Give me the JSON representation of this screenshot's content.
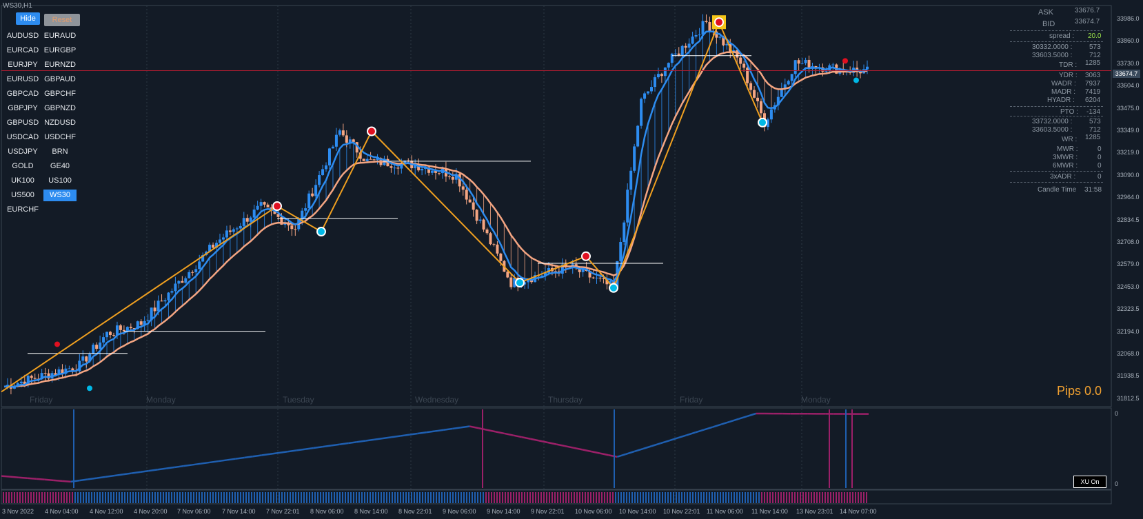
{
  "window": {
    "title": "WS30,H1"
  },
  "buttons": {
    "hide": "Hide",
    "reset": "Reset"
  },
  "symbols": [
    "AUDUSD",
    "EURAUD",
    "EURCAD",
    "EURGBP",
    "EURJPY",
    "EURNZD",
    "EURUSD",
    "GBPAUD",
    "GBPCAD",
    "GBPCHF",
    "GBPJPY",
    "GBPNZD",
    "GBPUSD",
    "NZDUSD",
    "USDCAD",
    "USDCHF",
    "USDJPY",
    "BRN",
    "GOLD",
    "GE40",
    "UK100",
    "US100",
    "US500",
    "WS30",
    "EURCHF"
  ],
  "active_symbol": "WS30",
  "info_panel": {
    "ask_label": "ASK",
    "ask_value": "33676.7",
    "bid_label": "BID",
    "bid_value": "33674.7",
    "spread_label": "spread :",
    "spread_value": "20.0",
    "r1_label": "30332.0000 :",
    "r1_value": "573",
    "r2_label": "33603.5000 :",
    "r2_value": "712",
    "tdr_label": "TDR :",
    "tdr_value": "1285",
    "ydr_label": "YDR :",
    "ydr_value": "3063",
    "wadr_label": "WADR :",
    "wadr_value": "7937",
    "madr_label": "MADR :",
    "madr_value": "7419",
    "hyadr_label": "HYADR :",
    "hyadr_value": "6204",
    "pto_label": "PTO :",
    "pto_value": "-134",
    "r3_label": "33732.0000 :",
    "r3_value": "573",
    "r4_label": "33603.5000 :",
    "r4_value": "712",
    "wr_label": "WR :",
    "wr_value": "1285",
    "mwr_label": "MWR :",
    "mwr_value": "0",
    "mwr3_label": "3MWR :",
    "mwr3_value": "0",
    "mwr6_label": "6MWR :",
    "mwr6_value": "0",
    "adr3_label": "3xADR :",
    "adr3_value": "0",
    "candle_label": "Candle Time",
    "candle_value": "31:58"
  },
  "price_axis": [
    "33986.0",
    "33860.0",
    "33730.0",
    "33604.0",
    "33475.0",
    "33349.0",
    "33219.0",
    "33090.0",
    "32964.0",
    "32834.5",
    "32708.0",
    "32579.0",
    "32453.0",
    "32323.5",
    "32194.0",
    "32068.0",
    "31938.5",
    "31812.5"
  ],
  "current_price": "33674.7",
  "time_axis": [
    "3 Nov 2022",
    "4 Nov 04:00",
    "4 Nov 12:00",
    "4 Nov 20:00",
    "7 Nov 06:00",
    "7 Nov 14:00",
    "7 Nov 22:01",
    "8 Nov 06:00",
    "8 Nov 14:00",
    "8 Nov 22:01",
    "9 Nov 06:00",
    "9 Nov 14:00",
    "9 Nov 22:01",
    "10 Nov 06:00",
    "10 Nov 14:00",
    "10 Nov 22:01",
    "11 Nov 06:00",
    "11 Nov 14:00",
    "13 Nov 23:01",
    "14 Nov 07:00"
  ],
  "day_labels": [
    "Friday",
    "Monday",
    "Tuesday",
    "Wednesday",
    "Thursday",
    "Friday",
    "Monday"
  ],
  "pips": "Pips 0.0",
  "xu_button": "XU On",
  "indicator_axis": {
    "top": "0",
    "bottom": "0"
  },
  "colors": {
    "bull": "#2d8cf0",
    "bear": "#f4a582",
    "zigzag": "#f0a020",
    "ma_fast": "#2d8cf0",
    "ma_slow": "#f4a582",
    "price_line": "#b01c30",
    "ind_up": "#1f5fb0",
    "ind_down": "#9b2068"
  },
  "chart_data": {
    "type": "candlestick",
    "title": "WS30,H1",
    "price_range": [
      31812.5,
      33986.0
    ],
    "zigzag": [
      {
        "time": "3 Nov 2022",
        "price": 31850
      },
      {
        "time": "7 Nov 22:01",
        "price": 32905
      },
      {
        "time": "8 Nov 06:00",
        "price": 32760
      },
      {
        "time": "8 Nov 14:00",
        "price": 33330
      },
      {
        "time": "9 Nov 22:01",
        "price": 32470
      },
      {
        "time": "10 Nov 06:00",
        "price": 32620
      },
      {
        "time": "10 Nov 14:00",
        "price": 32440
      },
      {
        "time": "11 Nov 06:00",
        "price": 33950
      },
      {
        "time": "11 Nov 14:00",
        "price": 33380
      }
    ],
    "current_price": 33674.7
  }
}
